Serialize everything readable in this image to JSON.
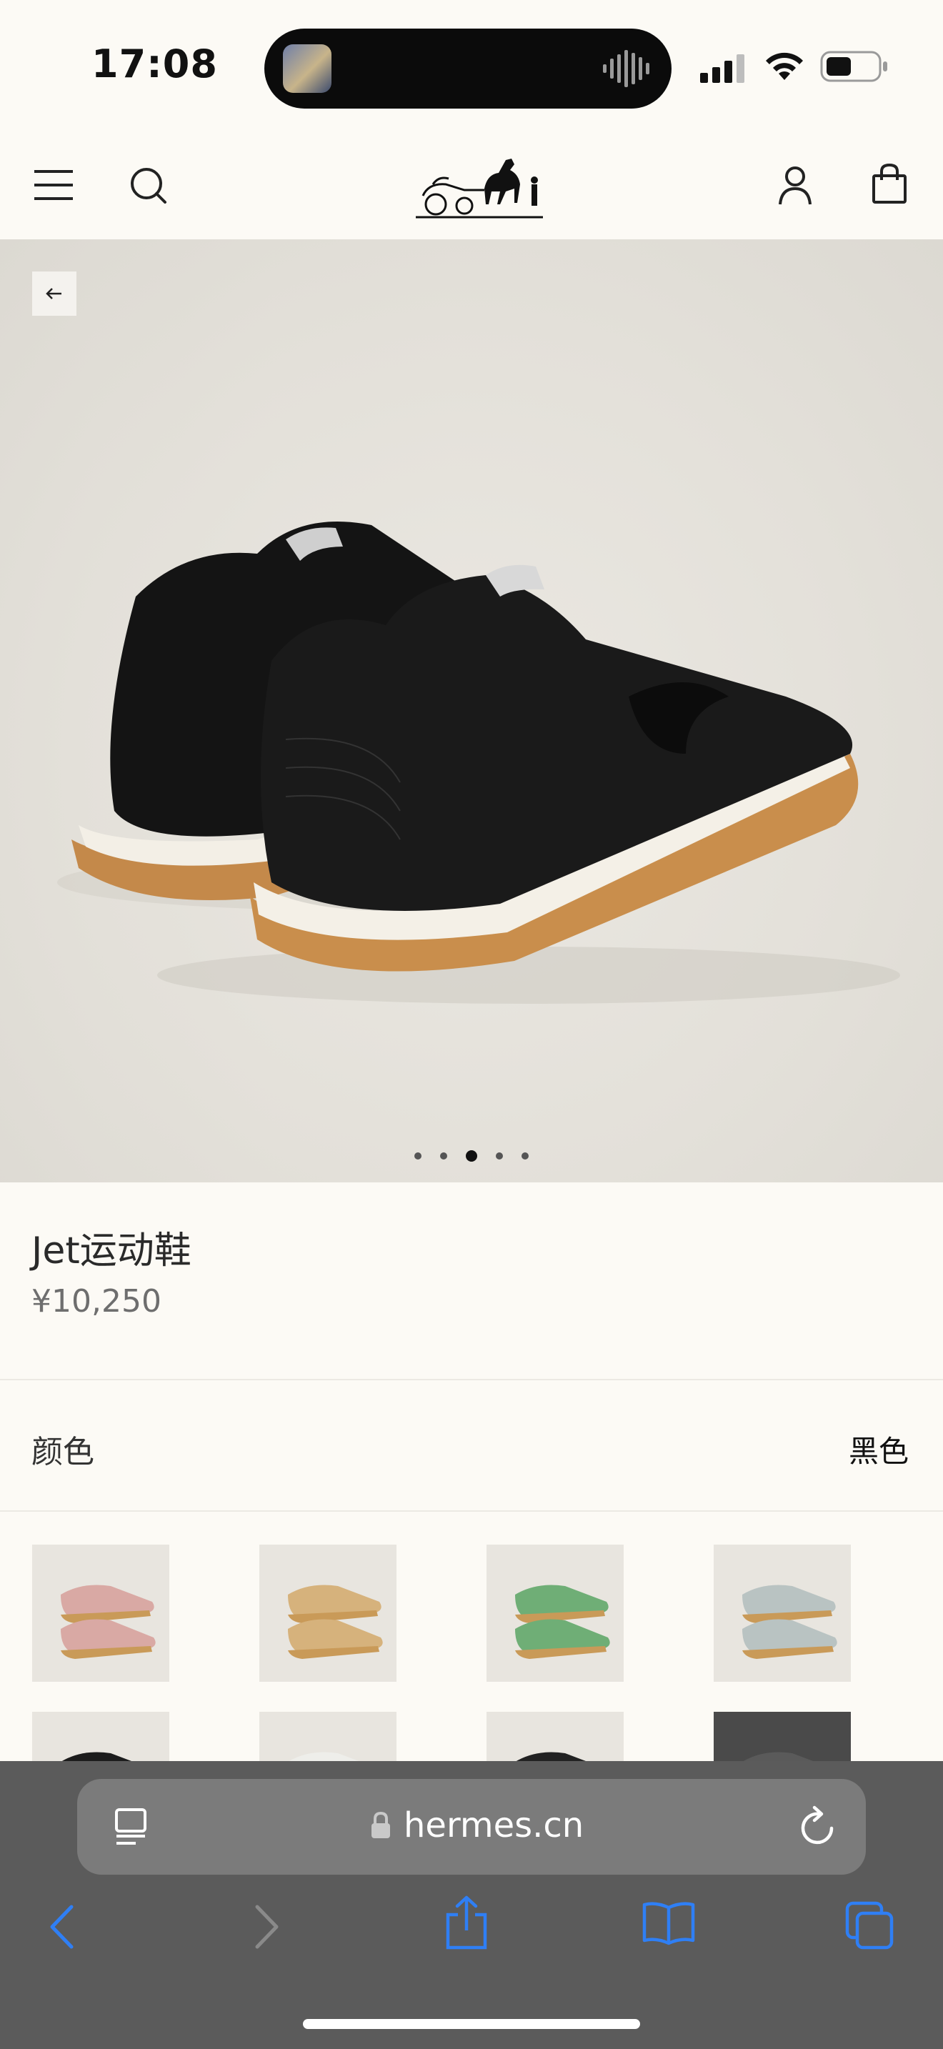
{
  "status_bar": {
    "time": "17:08"
  },
  "header": {
    "menu_icon": "menu-icon",
    "search_icon": "search-icon",
    "logo": "hermes-carriage-logo",
    "account_icon": "account-icon",
    "bag_icon": "shopping-bag-icon"
  },
  "hero": {
    "back_icon": "arrow-left-icon",
    "image": "black Jet sneakers pair",
    "carousel_count": 5,
    "carousel_active": 3
  },
  "product": {
    "name": "Jet运动鞋",
    "price": "¥10,250"
  },
  "color_section": {
    "label": "颜色",
    "selected": "黑色",
    "swatches": [
      {
        "color": "#d9a9a4",
        "sole": "#c99a58"
      },
      {
        "color": "#d6b27c",
        "sole": "#c99a58"
      },
      {
        "color": "#6fae76",
        "sole": "#c99a58"
      },
      {
        "color": "#b9c3c2",
        "sole": "#c99a58"
      },
      {
        "color": "#1c1c1c",
        "sole": "#1c1c1c"
      },
      {
        "color": "#eeeeea",
        "sole": "#e6e6e2"
      },
      {
        "color": "#222222",
        "sole": "#222222"
      },
      {
        "color": "#5a5a5a",
        "sole": "#5a5a5a"
      }
    ]
  },
  "browser": {
    "url": "hermes.cn",
    "reader_icon": "reader-icon",
    "lock_icon": "lock-icon",
    "reload_icon": "reload-icon",
    "toolbar": [
      "back-icon",
      "forward-icon",
      "share-icon",
      "bookmarks-icon",
      "tabs-icon"
    ],
    "accent": "#2f7ff5"
  }
}
